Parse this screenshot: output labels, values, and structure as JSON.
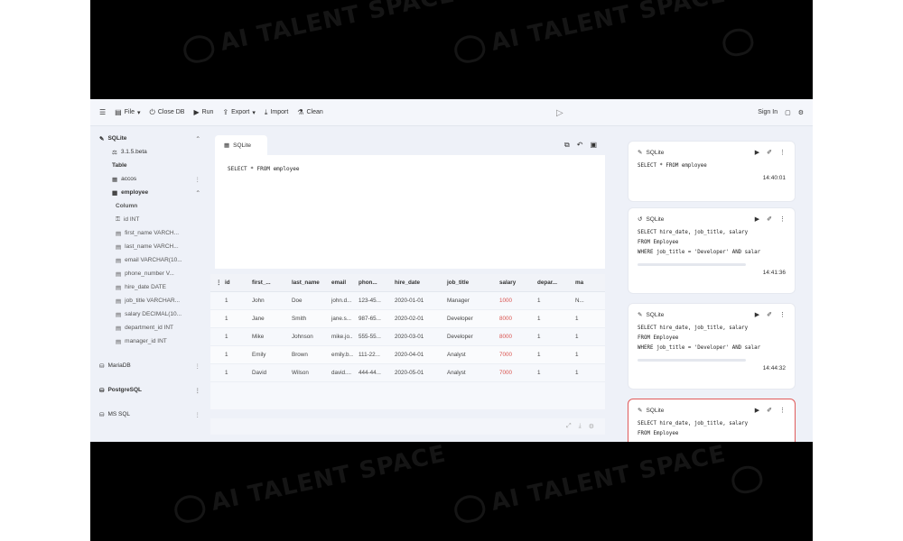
{
  "watermark": "AI TALENT SPACE",
  "toolbar": {
    "menu_icon": "hamburger-icon",
    "file": "File",
    "close_db": "Close DB",
    "run": "Run",
    "export": "Export",
    "import": "Import",
    "clean": "Clean",
    "sign_in": "Sign In"
  },
  "sidebar": {
    "sqlite": "SQLite",
    "version": "3.1.5.beta",
    "table_label": "Table",
    "table_accos": "accos",
    "table_employee": "employee",
    "column_label": "Column",
    "columns": [
      "id INT",
      "first_name VARCH...",
      "last_name VARCH...",
      "email VARCHAR(10...",
      "phone_number V...",
      "hire_date DATE",
      "job_title VARCHAR...",
      "salary DECIMAL(10...",
      "department_id INT",
      "manager_id INT"
    ],
    "mariadb": "MariaDB",
    "postgresql": "PostgreSQL",
    "mssql": "MS SQL"
  },
  "editor": {
    "tab": "SQLite",
    "query": "SELECT * FROM employee"
  },
  "results": {
    "headers": [
      "id",
      "first_...",
      "last_name",
      "email",
      "phon...",
      "hire_date",
      "job_title",
      "salary",
      "depar...",
      "ma"
    ],
    "rows": [
      [
        "1",
        "John",
        "Doe",
        "john.d...",
        "123-45...",
        "2020-01-01",
        "Manager",
        "1000",
        "1",
        "N..."
      ],
      [
        "1",
        "Jane",
        "Smith",
        "jane.s...",
        "987-65...",
        "2020-02-01",
        "Developer",
        "8000",
        "1",
        "1"
      ],
      [
        "1",
        "Mike",
        "Johnson",
        "mike.jo...",
        "555-55...",
        "2020-03-01",
        "Developer",
        "8000",
        "1",
        "1"
      ],
      [
        "1",
        "Emily",
        "Brown",
        "emily.b...",
        "111-22...",
        "2020-04-01",
        "Analyst",
        "7000",
        "1",
        "1"
      ],
      [
        "1",
        "David",
        "Wilson",
        "david....",
        "444-44...",
        "2020-05-01",
        "Analyst",
        "7000",
        "1",
        "1"
      ]
    ]
  },
  "history": [
    {
      "db": "SQLite",
      "code": [
        "SELECT * FROM employee"
      ],
      "time": "14:40:01"
    },
    {
      "db": "SQLite",
      "code": [
        "SELECT hire_date, job_title, salary",
        "FROM Employee",
        "WHERE job_title = 'Developer' AND salar"
      ],
      "time": "14:41:36"
    },
    {
      "db": "SQLite",
      "code": [
        "SELECT hire_date, job_title, salary",
        "FROM Employee",
        "WHERE job_title = 'Developer' AND salar"
      ],
      "time": "14:44:32"
    },
    {
      "db": "SQLite",
      "code": [
        "SELECT hire_date, job_title, salary",
        "FROM Employee"
      ],
      "time": ""
    }
  ]
}
